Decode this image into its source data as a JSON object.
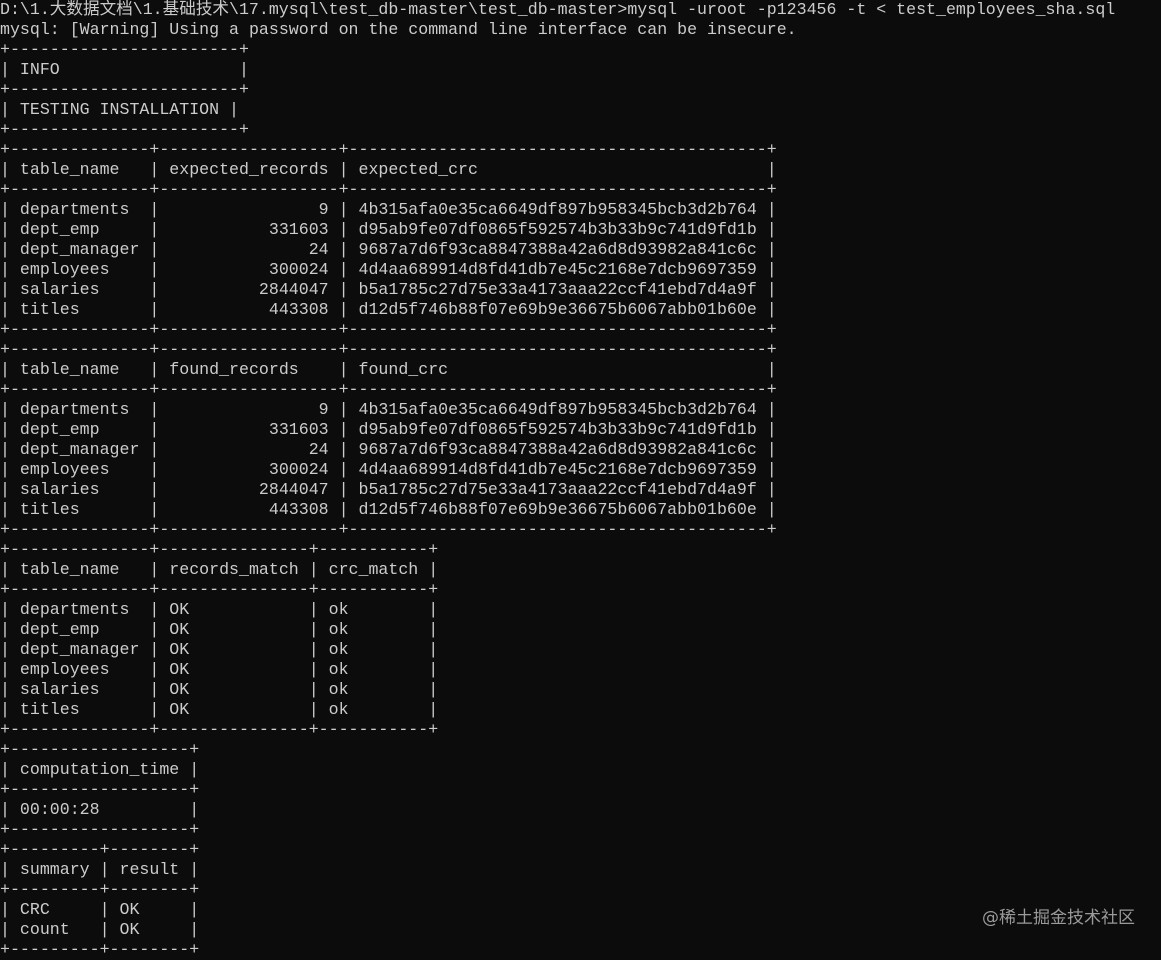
{
  "terminal": {
    "lines": [
      "D:\\1.大数据文档\\1.基础技术\\17.mysql\\test_db-master\\test_db-master>mysql -uroot -p123456 -t < test_employees_sha.sql",
      "mysql: [Warning] Using a password on the command line interface can be insecure.",
      "+-----------------------+",
      "| INFO                  |",
      "+-----------------------+",
      "| TESTING INSTALLATION |",
      "+-----------------------+",
      "+--------------+------------------+------------------------------------------+",
      "| table_name   | expected_records | expected_crc                             |",
      "+--------------+------------------+------------------------------------------+",
      "| departments  |                9 | 4b315afa0e35ca6649df897b958345bcb3d2b764 |",
      "| dept_emp     |           331603 | d95ab9fe07df0865f592574b3b33b9c741d9fd1b |",
      "| dept_manager |               24 | 9687a7d6f93ca8847388a42a6d8d93982a841c6c |",
      "| employees    |           300024 | 4d4aa689914d8fd41db7e45c2168e7dcb9697359 |",
      "| salaries     |          2844047 | b5a1785c27d75e33a4173aaa22ccf41ebd7d4a9f |",
      "| titles       |           443308 | d12d5f746b88f07e69b9e36675b6067abb01b60e |",
      "+--------------+------------------+------------------------------------------+",
      "+--------------+------------------+------------------------------------------+",
      "| table_name   | found_records    | found_crc                                |",
      "+--------------+------------------+------------------------------------------+",
      "| departments  |                9 | 4b315afa0e35ca6649df897b958345bcb3d2b764 |",
      "| dept_emp     |           331603 | d95ab9fe07df0865f592574b3b33b9c741d9fd1b |",
      "| dept_manager |               24 | 9687a7d6f93ca8847388a42a6d8d93982a841c6c |",
      "| employees    |           300024 | 4d4aa689914d8fd41db7e45c2168e7dcb9697359 |",
      "| salaries     |          2844047 | b5a1785c27d75e33a4173aaa22ccf41ebd7d4a9f |",
      "| titles       |           443308 | d12d5f746b88f07e69b9e36675b6067abb01b60e |",
      "+--------------+------------------+------------------------------------------+",
      "+--------------+---------------+-----------+",
      "| table_name   | records_match | crc_match |",
      "+--------------+---------------+-----------+",
      "| departments  | OK            | ok        |",
      "| dept_emp     | OK            | ok        |",
      "| dept_manager | OK            | ok        |",
      "| employees    | OK            | ok        |",
      "| salaries     | OK            | ok        |",
      "| titles       | OK            | ok        |",
      "+--------------+---------------+-----------+",
      "+------------------+",
      "| computation_time |",
      "+------------------+",
      "| 00:00:28         |",
      "+------------------+",
      "+---------+--------+",
      "| summary | result |",
      "+---------+--------+",
      "| CRC     | OK     |",
      "| count   | OK     |",
      "+---------+--------+"
    ]
  },
  "watermark": "@稀土掘金技术社区"
}
